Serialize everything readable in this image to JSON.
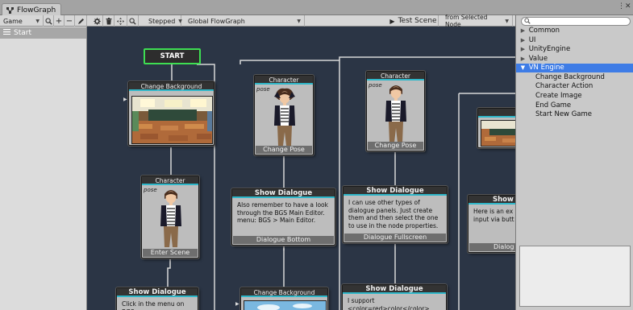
{
  "window": {
    "tab_title": "FlowGraph",
    "controls": "⋮"
  },
  "toolbar": {
    "game_label": "Game",
    "stepped_label": "Stepped",
    "flowgraph_label": "Global FlowGraph",
    "test_scene_label": "Test Scene",
    "from_selected_label": "from Selected Node"
  },
  "sidebar": {
    "items": [
      {
        "label": "Start"
      }
    ]
  },
  "graph": {
    "start_label": "START",
    "col1": {
      "change_bg_title": "Change Background",
      "character_title": "Character",
      "pose_label": "pose",
      "enter_scene_label": "Enter Scene",
      "show_dialogue_title": "Show Dialogue",
      "dialogue_text": "Click in the menu on BGS >"
    },
    "col2": {
      "character_title": "Character",
      "pose_label": "pose",
      "change_pose_label": "Change Pose",
      "show_dialogue_title": "Show Dialogue",
      "dialogue_text": "Also remember to have a look through the BGS Main Editor. menu: BGS > Main Editor.",
      "dialogue_bottom_label": "Dialogue  Bottom",
      "change_bg_title": "Change Background"
    },
    "col3": {
      "character_title": "Character",
      "pose_label": "pose",
      "change_pose_label": "Change  Pose",
      "show_dialogue_title": "Show Dialogue",
      "dialogue_text": "I can use other types of dialogue panels. Just create them and then select the one to use in the node properties.",
      "dialogue_fullscreen_label": "Dialogue Fullscreen",
      "show_dialogue2_title": "Show Dialogue",
      "dialogue2_text": "I support <color=red>color</color> and"
    },
    "col4": {
      "show_dialogue_title": "Show",
      "dialogue_text": "Here is an ex input via butt",
      "dialogue_foot": "Dialog"
    }
  },
  "palette": {
    "search_placeholder": "",
    "categories": [
      {
        "label": "Common",
        "arrow": "▶"
      },
      {
        "label": "UI",
        "arrow": "▶"
      },
      {
        "label": "UnityEngine",
        "arrow": "▶"
      },
      {
        "label": "Value",
        "arrow": "▶"
      },
      {
        "label": "VN Engine",
        "arrow": "▼"
      }
    ],
    "vn_items": [
      "Change Background",
      "Character Action",
      "Create Image",
      "End Game",
      "Start New Game"
    ]
  },
  "colors": {
    "canvas_bg": "#2b3545",
    "start_border": "#3ede52",
    "header_accent": "#2fb7c9",
    "selection": "#3e7ce6"
  }
}
